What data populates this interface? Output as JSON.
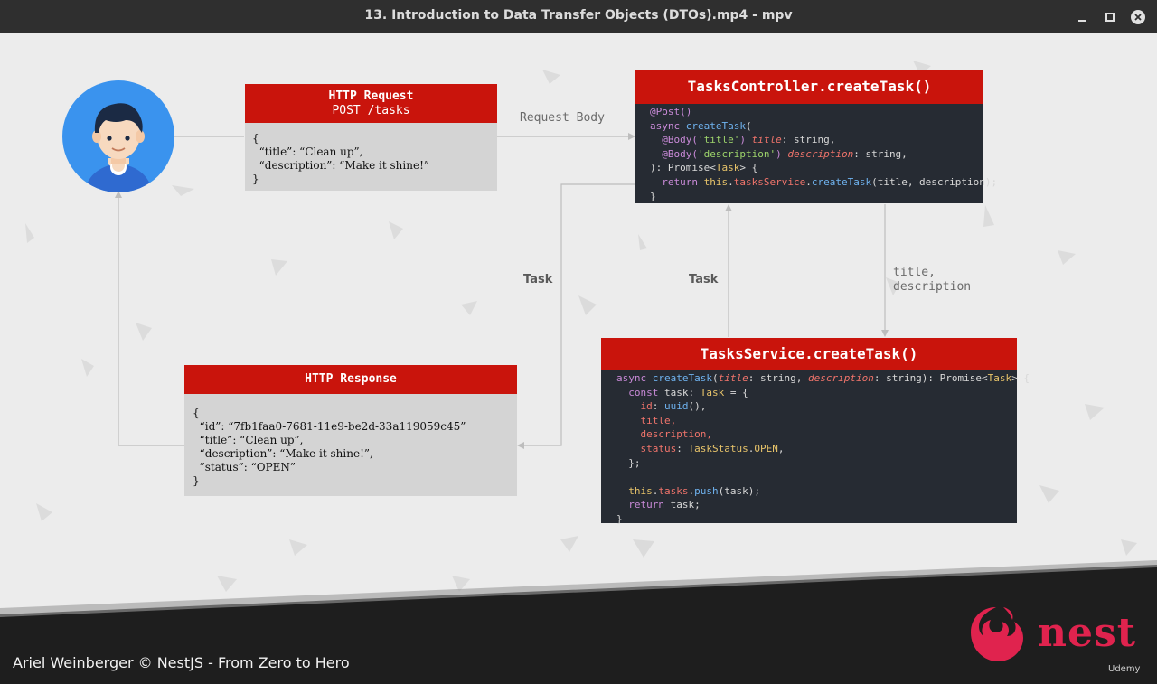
{
  "window": {
    "title": "13. Introduction to Data Transfer Objects (DTOs).mp4 - mpv",
    "controls": {
      "minimize_icon": "minimize-icon",
      "maximize_icon": "maximize-icon",
      "close_icon": "close-icon"
    }
  },
  "diagram": {
    "request": {
      "title": "HTTP Request",
      "subtitle": "POST /tasks",
      "body_lines": [
        "{",
        "  “title”: “Clean up”,",
        "  “description”: “Make it shine!”",
        "}"
      ]
    },
    "response": {
      "title": "HTTP Response",
      "body_lines": [
        "{",
        "  “id”: “7fb1faa0-7681-11e9-be2d-33a119059c45”",
        "  “title”: “Clean up”,",
        "  “description”: “Make it shine!”,",
        "  ”status”: “OPEN”",
        "}"
      ]
    },
    "controller": {
      "title": "TasksController.createTask()",
      "code": {
        "l1": "@Post()",
        "l2a": "async ",
        "l2b": "createTask",
        "l2c": "(",
        "l3a": "@Body(",
        "l3b": "'title'",
        "l3c": ") ",
        "l3d": "title",
        "l3e": ": string,",
        "l4a": "@Body(",
        "l4b": "'description'",
        "l4c": ") ",
        "l4d": "description",
        "l4e": ": string,",
        "l5a": "): Promise<",
        "l5b": "Task",
        "l5c": "> {",
        "l6a": "return ",
        "l6b": "this",
        "l6c": ".",
        "l6d": "tasksService",
        "l6e": ".",
        "l6f": "createTask",
        "l6g": "(title, description);",
        "l7": "}"
      }
    },
    "service": {
      "title": "TasksService.createTask()",
      "code": {
        "l1a": "async ",
        "l1b": "createTask",
        "l1c": "(",
        "l1d": "title",
        "l1e": ": string, ",
        "l1f": "description",
        "l1g": ": string): Promise<",
        "l1h": "Task",
        "l1i": "> {",
        "l2a": "const ",
        "l2b": "task",
        "l2c": ": ",
        "l2d": "Task",
        "l2e": " = {",
        "l3a": "id",
        "l3b": ": ",
        "l3c": "uuid",
        "l3d": "(),",
        "l4": "title,",
        "l5": "description,",
        "l6a": "status",
        "l6b": ": ",
        "l6c": "TaskStatus",
        "l6d": ".",
        "l6e": "OPEN",
        "l6f": ",",
        "l7": "};",
        "l8a": "this",
        "l8b": ".",
        "l8c": "tasks",
        "l8d": ".",
        "l8e": "push",
        "l8f": "(task);",
        "l9a": "return ",
        "l9b": "task",
        "l9c": ";",
        "l10": "}"
      }
    },
    "labels": {
      "request_body": "Request Body",
      "task_left": "Task",
      "task_center": "Task",
      "title_desc_1": "title,",
      "title_desc_2": "description"
    }
  },
  "footer": {
    "credit": "Ariel Weinberger © NestJS - From Zero to Hero",
    "brand": "nest",
    "udemy": "Udemy"
  },
  "colors": {
    "accent_red": "#c9140c",
    "code_bg": "#262b33",
    "nest_red": "#e0234e",
    "titlebar": "#2f2f2f"
  }
}
